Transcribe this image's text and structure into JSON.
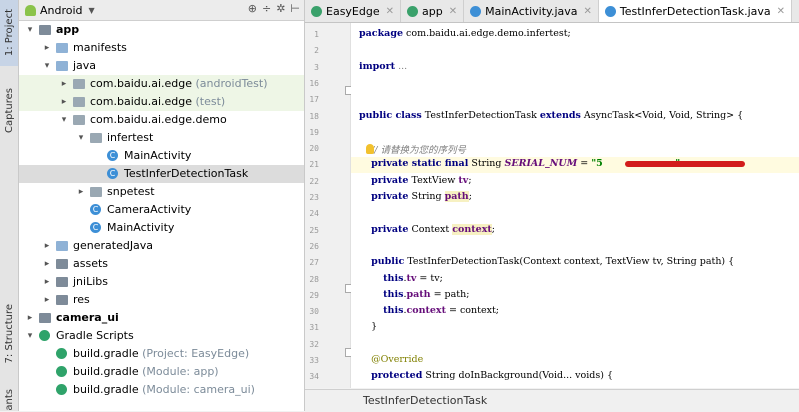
{
  "toolstrip": {
    "project": "1: Project",
    "captures": "Captures",
    "structure": "7: Structure",
    "favorites": "ants"
  },
  "project_panel": {
    "view": "Android",
    "tree": [
      {
        "label": "app",
        "suffix": "",
        "depth": 0,
        "kind": "folder-dark",
        "arrow": "▾",
        "bold": true
      },
      {
        "label": "manifests",
        "suffix": "",
        "depth": 1,
        "kind": "folder",
        "arrow": "▸"
      },
      {
        "label": "java",
        "suffix": "",
        "depth": 1,
        "kind": "folder",
        "arrow": "▾"
      },
      {
        "label": "com.baidu.ai.edge",
        "suffix": "(androidTest)",
        "depth": 2,
        "kind": "pkg",
        "arrow": "▸",
        "hl": true
      },
      {
        "label": "com.baidu.ai.edge",
        "suffix": "(test)",
        "depth": 2,
        "kind": "pkg",
        "arrow": "▸",
        "hl": true
      },
      {
        "label": "com.baidu.ai.edge.demo",
        "suffix": "",
        "depth": 2,
        "kind": "pkg",
        "arrow": "▾"
      },
      {
        "label": "infertest",
        "suffix": "",
        "depth": 3,
        "kind": "pkg",
        "arrow": "▾"
      },
      {
        "label": "MainActivity",
        "suffix": "",
        "depth": 4,
        "kind": "cls",
        "arrow": ""
      },
      {
        "label": "TestInferDetectionTask",
        "suffix": "",
        "depth": 4,
        "kind": "cls",
        "arrow": "",
        "sel": true
      },
      {
        "label": "snpetest",
        "suffix": "",
        "depth": 3,
        "kind": "pkg",
        "arrow": "▸"
      },
      {
        "label": "CameraActivity",
        "suffix": "",
        "depth": 3,
        "kind": "cls",
        "arrow": ""
      },
      {
        "label": "MainActivity",
        "suffix": "",
        "depth": 3,
        "kind": "cls",
        "arrow": ""
      },
      {
        "label": "generatedJava",
        "suffix": "",
        "depth": 1,
        "kind": "folder",
        "arrow": "▸"
      },
      {
        "label": "assets",
        "suffix": "",
        "depth": 1,
        "kind": "folder-dark",
        "arrow": "▸"
      },
      {
        "label": "jniLibs",
        "suffix": "",
        "depth": 1,
        "kind": "folder-dark",
        "arrow": "▸"
      },
      {
        "label": "res",
        "suffix": "",
        "depth": 1,
        "kind": "folder-dark",
        "arrow": "▸"
      },
      {
        "label": "camera_ui",
        "suffix": "",
        "depth": 0,
        "kind": "folder-dark",
        "arrow": "▸",
        "bold": true
      },
      {
        "label": "Gradle Scripts",
        "suffix": "",
        "depth": 0,
        "kind": "grad",
        "arrow": "▾"
      },
      {
        "label": "build.gradle",
        "suffix": "(Project: EasyEdge)",
        "depth": 1,
        "kind": "grad",
        "arrow": ""
      },
      {
        "label": "build.gradle",
        "suffix": "(Module: app)",
        "depth": 1,
        "kind": "grad",
        "arrow": ""
      },
      {
        "label": "build.gradle",
        "suffix": "(Module: camera_ui)",
        "depth": 1,
        "kind": "grad",
        "arrow": ""
      }
    ]
  },
  "tabs": [
    {
      "label": "EasyEdge",
      "color": "#3aa16b"
    },
    {
      "label": "app",
      "color": "#3aa16b"
    },
    {
      "label": "MainActivity.java",
      "color": "#3d8fd6"
    },
    {
      "label": "TestInferDetectionTask.java",
      "color": "#3d8fd6",
      "active": true
    }
  ],
  "code_lines": [
    {
      "n": "1",
      "html": "<span class='kw'>package</span> com.baidu.ai.edge.demo.infertest;"
    },
    {
      "n": "2",
      "html": ""
    },
    {
      "n": "3",
      "html": "<span class='kw'>import</span> <span class='cmt'>...</span>"
    },
    {
      "n": "16",
      "html": ""
    },
    {
      "n": "17",
      "html": ""
    },
    {
      "n": "18",
      "html": "<span class='kw'>public class</span> TestInferDetectionTask <span class='kw'>extends</span> AsyncTask&lt;Void, Void, String&gt; {"
    },
    {
      "n": "19",
      "html": ""
    },
    {
      "n": "20",
      "html": "    <span class='cmt'>// 请替换为您的序列号</span>"
    },
    {
      "n": "21",
      "html": "    <span class='kw'>private static final</span> String <span class='cst'>SERIAL_NUM</span> = <span class='str'>\"5</span>                        <span class='str'>\"</span>;"
    },
    {
      "n": "22",
      "html": "    <span class='kw'>private</span> TextView <span class='fld'>tv</span>;"
    },
    {
      "n": "23",
      "html": "    <span class='kw'>private</span> String <span class='fld hlparam'>path</span>;"
    },
    {
      "n": "24",
      "html": ""
    },
    {
      "n": "25",
      "html": "    <span class='kw'>private</span> Context <span class='fld hlparam'>context</span>;"
    },
    {
      "n": "26",
      "html": ""
    },
    {
      "n": "27",
      "html": "    <span class='kw'>public</span> TestInferDetectionTask(Context context, TextView tv, String path) {"
    },
    {
      "n": "28",
      "html": "        <span class='kw'>this</span>.<span class='fld'>tv</span> = tv;"
    },
    {
      "n": "29",
      "html": "        <span class='kw'>this</span>.<span class='fld'>path</span> = path;"
    },
    {
      "n": "30",
      "html": "        <span class='kw'>this</span>.<span class='fld'>context</span> = context;"
    },
    {
      "n": "31",
      "html": "    }"
    },
    {
      "n": "32",
      "html": ""
    },
    {
      "n": "33",
      "html": "    <span class='ann'>@Override</span>"
    },
    {
      "n": "34",
      "html": "    <span class='kw'>protected</span> String doInBackground(Void... voids) {"
    }
  ],
  "breadcrumb": "TestInferDetectionTask"
}
